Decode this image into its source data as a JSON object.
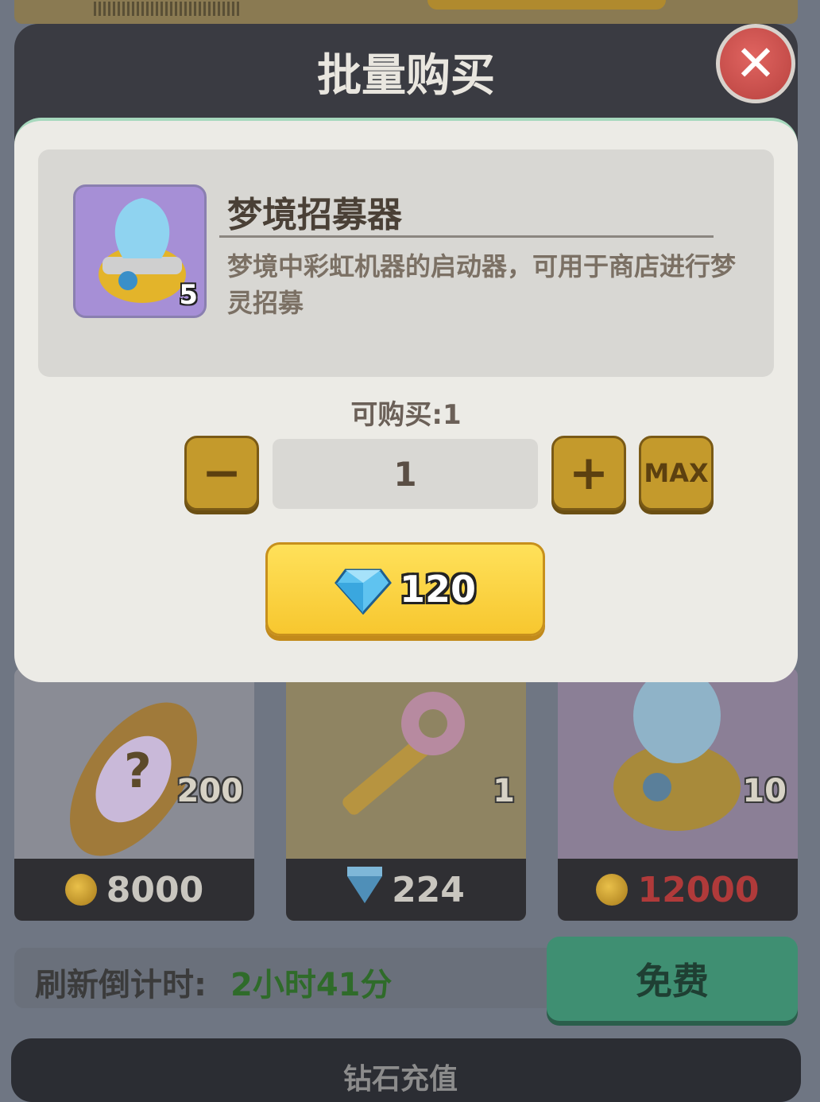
{
  "dialog": {
    "title": "批量购买",
    "item": {
      "name": "梦境招募器",
      "count": "5",
      "description": "梦境中彩虹机器的启动器，可用于商店进行梦灵招募"
    },
    "available_label": "可购买:1",
    "quantity": "1",
    "max_label": "MAX",
    "price": "120",
    "minus_symbol": "−",
    "plus_symbol": "+"
  },
  "shop": {
    "items": [
      {
        "qty": "200",
        "price": "8000",
        "currency": "coin"
      },
      {
        "qty": "1",
        "price": "224",
        "currency": "gem"
      },
      {
        "qty": "10",
        "price": "12000",
        "currency": "coin"
      }
    ],
    "refresh_label": "刷新倒计时:",
    "refresh_value": "2小时41分",
    "free_button": "免费",
    "bottom_tab": "钻石充值"
  },
  "colors": {
    "accent_yellow": "#f7c72f",
    "stepper_gold": "#c49a2c",
    "close_red": "#c94b48",
    "free_green": "#3f8f72"
  }
}
